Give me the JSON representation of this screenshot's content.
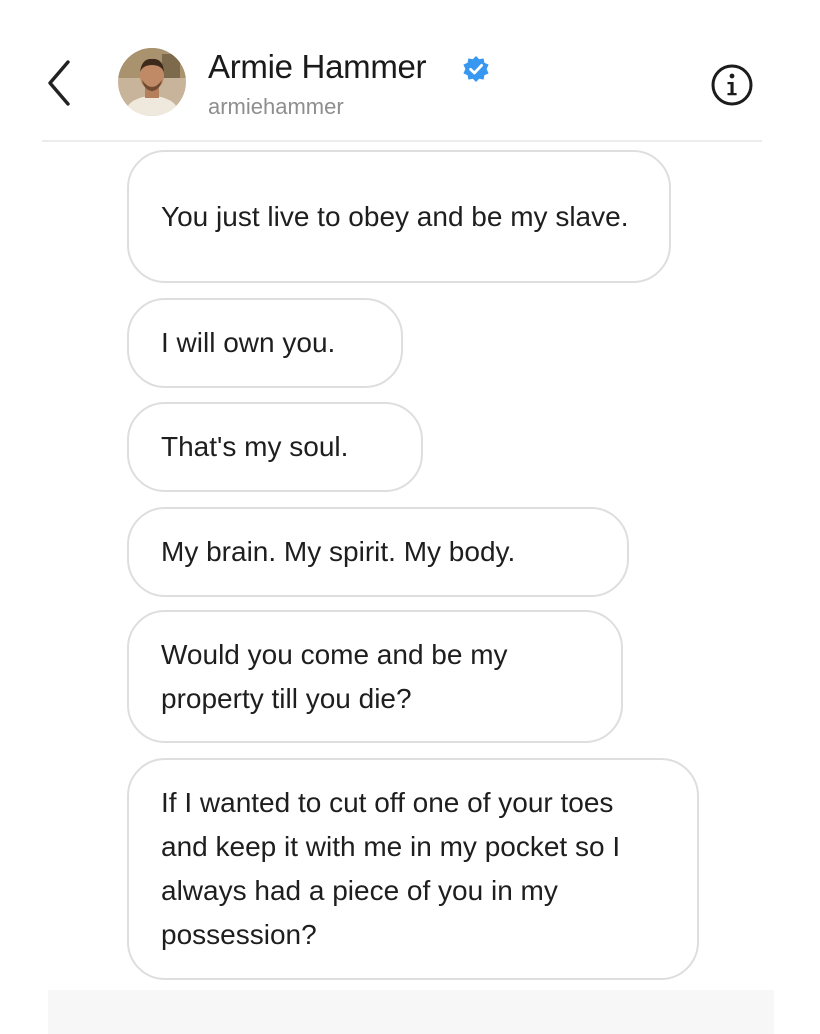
{
  "header": {
    "contact_name": "Armie Hammer",
    "contact_handle": "armiehammer",
    "icons": {
      "back": "chevron-left-icon",
      "verified": "verified-badge-icon",
      "info": "info-icon"
    },
    "colors": {
      "verified_blue": "#3897f0",
      "handle_gray": "#8e8e8e"
    }
  },
  "messages": [
    {
      "text": "You just live to obey and be my slave."
    },
    {
      "text": "I will own you."
    },
    {
      "text": "That's my soul."
    },
    {
      "text": "My brain. My spirit. My body."
    },
    {
      "text": "Would you come and be my property till you die?"
    },
    {
      "text": "If I wanted to cut off one of your toes and keep it with me in my pocket so I always had a piece of you in my possession?"
    }
  ]
}
